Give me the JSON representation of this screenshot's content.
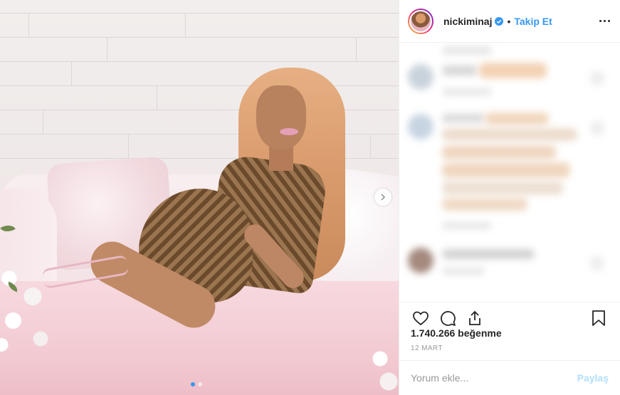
{
  "post": {
    "username": "nickiminaj",
    "separator": "•",
    "follow_label": "Takip Et",
    "likes_text": "1.740.266 beğenme",
    "date_text": "12 MART",
    "comment_placeholder": "Yorum ekle...",
    "share_label": "Paylaş",
    "carousel_total": 2,
    "carousel_index": 1
  },
  "icons": {
    "verified": "verified-badge-icon",
    "more": "more-options-icon",
    "like": "heart-icon",
    "comment": "comment-icon",
    "share": "share-icon",
    "save": "bookmark-icon",
    "next": "chevron-right-icon"
  },
  "colors": {
    "accent": "#3897f0",
    "text": "#262626",
    "muted": "#999999",
    "share_disabled": "#b2dffc"
  }
}
